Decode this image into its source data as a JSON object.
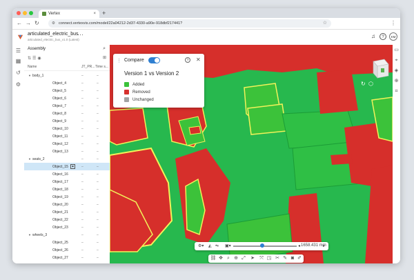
{
  "browser": {
    "tab_title": "Vertex",
    "tab_close": "×",
    "new_tab": "+",
    "back": "←",
    "forward": "→",
    "reload": "↻",
    "url": "connect.vertexvis.com/model/22a04212-2d37-4330-a90e-918dbf217441?",
    "bookmark": "☆",
    "menu": "⋮"
  },
  "app": {
    "title": "articulated_electric_bus",
    "subtitle": "articulated_electric_bus_v1.0 (Latest)",
    "more": "···",
    "notifications": "🔔",
    "help": "?",
    "avatar": "KM"
  },
  "panel": {
    "header": "Assembly",
    "columns": [
      "Name",
      "JT_PR...",
      "Time s..."
    ],
    "rows": [
      {
        "label": "body_1",
        "level": 1,
        "expander": "▼",
        "c1": "–",
        "c2": "–",
        "selected": false
      },
      {
        "label": "Object_4",
        "level": 2,
        "c1": "–",
        "c2": "–",
        "selected": false
      },
      {
        "label": "Object_5",
        "level": 2,
        "c1": "–",
        "c2": "–",
        "selected": false
      },
      {
        "label": "Object_6",
        "level": 2,
        "c1": "–",
        "c2": "–",
        "selected": false
      },
      {
        "label": "Object_7",
        "level": 2,
        "c1": "–",
        "c2": "–",
        "selected": false
      },
      {
        "label": "Object_8",
        "level": 2,
        "c1": "–",
        "c2": "–",
        "selected": false
      },
      {
        "label": "Object_9",
        "level": 2,
        "c1": "–",
        "c2": "–",
        "selected": false
      },
      {
        "label": "Object_10",
        "level": 2,
        "c1": "–",
        "c2": "–",
        "selected": false
      },
      {
        "label": "Object_11",
        "level": 2,
        "c1": "–",
        "c2": "–",
        "selected": false
      },
      {
        "label": "Object_12",
        "level": 2,
        "c1": "–",
        "c2": "–",
        "selected": false
      },
      {
        "label": "Object_13",
        "level": 2,
        "c1": "–",
        "c2": "–",
        "selected": false
      },
      {
        "label": "seats_2",
        "level": 1,
        "expander": "▼",
        "c1": "–",
        "c2": "–",
        "selected": false
      },
      {
        "label": "Object_15",
        "level": 2,
        "c1": "–",
        "c2": "–",
        "selected": true
      },
      {
        "label": "Object_16",
        "level": 2,
        "c1": "–",
        "c2": "–",
        "selected": false
      },
      {
        "label": "Object_17",
        "level": 2,
        "c1": "–",
        "c2": "–",
        "selected": false
      },
      {
        "label": "Object_18",
        "level": 2,
        "c1": "–",
        "c2": "–",
        "selected": false
      },
      {
        "label": "Object_19",
        "level": 2,
        "c1": "–",
        "c2": "–",
        "selected": false
      },
      {
        "label": "Object_20",
        "level": 2,
        "c1": "–",
        "c2": "–",
        "selected": false
      },
      {
        "label": "Object_21",
        "level": 2,
        "c1": "–",
        "c2": "–",
        "selected": false
      },
      {
        "label": "Object_22",
        "level": 2,
        "c1": "–",
        "c2": "–",
        "selected": false
      },
      {
        "label": "Object_23",
        "level": 2,
        "c1": "–",
        "c2": "–",
        "selected": false
      },
      {
        "label": "wheels_3",
        "level": 1,
        "expander": "▼",
        "c1": "–",
        "c2": "–",
        "selected": false
      },
      {
        "label": "Object_25",
        "level": 2,
        "c1": "–",
        "c2": "–",
        "selected": false
      },
      {
        "label": "Object_26",
        "level": 2,
        "c1": "–",
        "c2": "–",
        "selected": false
      },
      {
        "label": "Object_27",
        "level": 2,
        "c1": "–",
        "c2": "–",
        "selected": false
      }
    ]
  },
  "compare": {
    "title": "Compare",
    "toggle_on": true,
    "help": "?",
    "close": "✕",
    "versions": "Version 1 vs Version 2",
    "legend": [
      {
        "label": "Added",
        "color": "#3cc23a"
      },
      {
        "label": "Removed",
        "color": "#d6312e"
      },
      {
        "label": "Unchanged",
        "color": "#a3a3a3"
      }
    ]
  },
  "viewer": {
    "added_color": "#27b84e",
    "removed_color": "#d62f2b",
    "outline_color": "#f2f25a",
    "distance": "1658.431 mm"
  },
  "colors": {
    "accent": "#2f7fd1"
  }
}
